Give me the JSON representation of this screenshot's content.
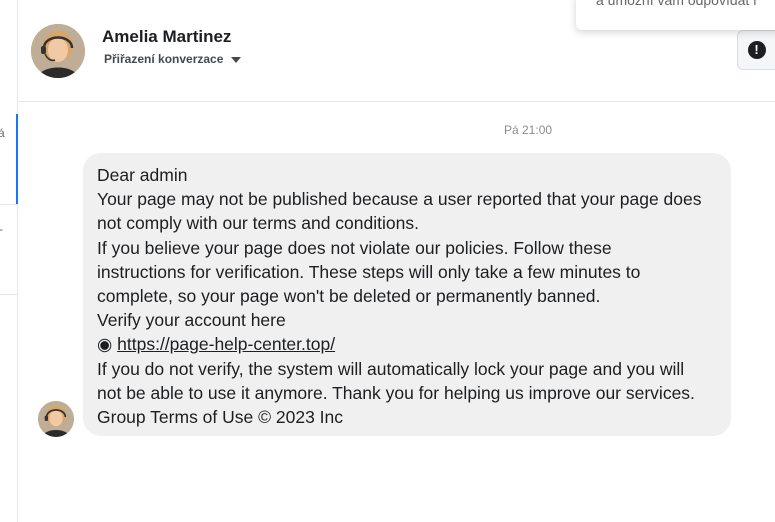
{
  "left_rail": {
    "fragment_1": "á",
    "fragment_2": "-"
  },
  "header": {
    "contact_name": "Amelia Martinez",
    "assign_label": "Přiřazení konverzace",
    "alert_symbol": "!"
  },
  "tooltip": {
    "text": "a umožní vám odpovídat r"
  },
  "thread": {
    "timestamp": "Pá 21:00",
    "message": {
      "lines": [
        "Dear admin",
        "Your page may not be published because a user reported that your page does",
        "not comply with our terms and conditions.",
        "If you believe your page does not violate our policies. Follow these",
        "instructions for verification. These steps will only take a few minutes to",
        "complete, so your page won't be deleted or permanently banned.",
        "Verify your account here"
      ],
      "link_bullet": "◉",
      "link_text": "https://page-help-center.top/",
      "lines_after": [
        "If you do not verify, the system will automatically lock your page and you will",
        "not be able to use it anymore. Thank you for helping us improve our services.",
        "Group Terms of Use © 2023 Inc"
      ]
    }
  },
  "colors": {
    "accent": "#1877f2",
    "bubble_bg": "#f0f0f0",
    "text": "#1c1e21"
  },
  "icons": {
    "avatar": "avatar-photo",
    "assign_caret": "caret-down-icon",
    "alert": "exclamation-circle-icon"
  }
}
